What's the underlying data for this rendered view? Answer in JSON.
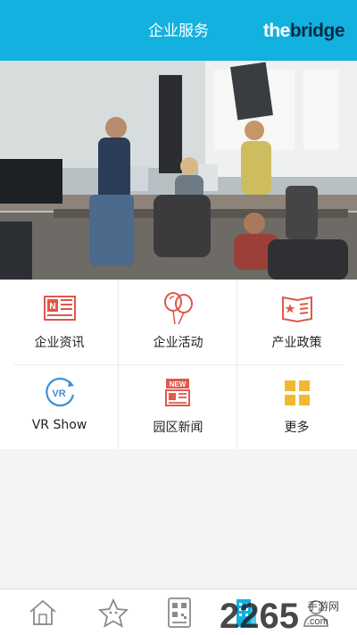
{
  "header": {
    "title": "企业服务",
    "logo_the": "the",
    "logo_bridge": "bridge"
  },
  "menu": {
    "items": [
      {
        "label": "企业资讯",
        "icon": "newspaper-icon"
      },
      {
        "label": "企业活动",
        "icon": "balloons-icon"
      },
      {
        "label": "产业政策",
        "icon": "policy-book-icon"
      },
      {
        "label": "VR Show",
        "icon": "vr-icon"
      },
      {
        "label": "园区新闻",
        "icon": "news-board-icon"
      },
      {
        "label": "更多",
        "icon": "more-grid-icon"
      }
    ]
  },
  "tabbar": {
    "tabs": [
      {
        "icon": "home-icon"
      },
      {
        "icon": "star-icon"
      },
      {
        "icon": "qr-code-icon"
      },
      {
        "icon": "building-icon",
        "active": true
      },
      {
        "icon": "profile-icon"
      }
    ]
  },
  "watermark": {
    "number": "2265",
    "suffix": ".com",
    "text": "手游网"
  },
  "colors": {
    "header": "#12b1df",
    "icon_red": "#e0584a",
    "icon_blue": "#3b8fd8",
    "icon_yellow": "#f2b830",
    "tab_active": "#12b1df"
  }
}
